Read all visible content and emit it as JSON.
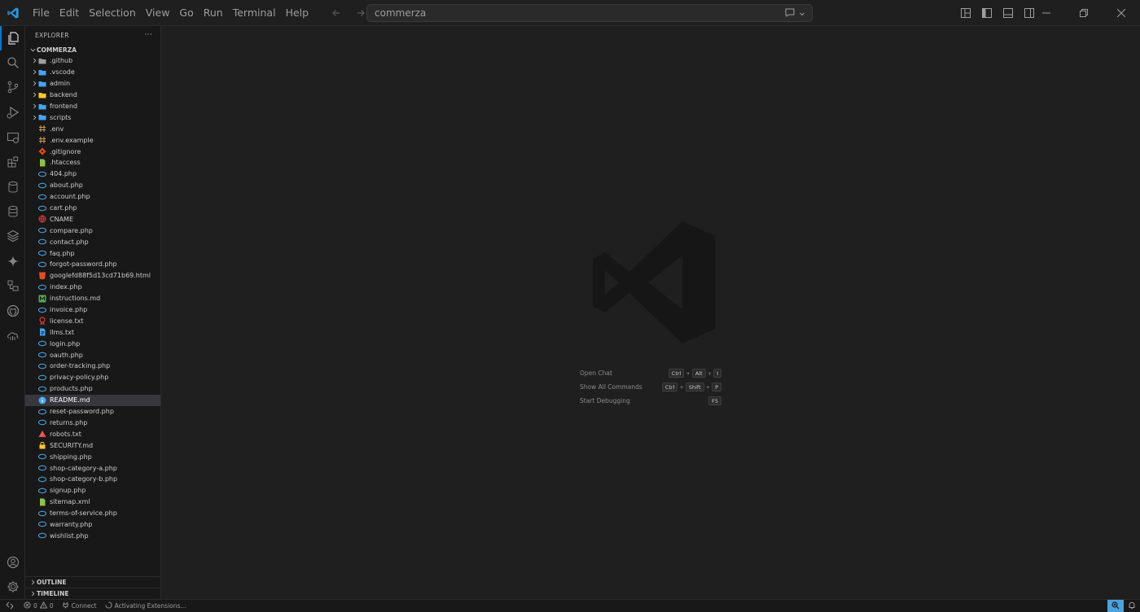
{
  "menu": [
    "File",
    "Edit",
    "Selection",
    "View",
    "Go",
    "Run",
    "Terminal",
    "Help"
  ],
  "command_center": {
    "text": "commerza"
  },
  "explorer": {
    "header": "EXPLORER",
    "more": "···",
    "root": "COMMERZA",
    "items": [
      {
        "name": ".github",
        "type": "folder",
        "icon": "github-folder-icon",
        "color": "#9e9e9e"
      },
      {
        "name": ".vscode",
        "type": "folder",
        "icon": "vscode-folder-icon",
        "color": "#42a5f5"
      },
      {
        "name": "admin",
        "type": "folder",
        "icon": "admin-folder-icon",
        "color": "#42a5f5"
      },
      {
        "name": "backend",
        "type": "folder",
        "icon": "folder-icon",
        "color": "#ffca28"
      },
      {
        "name": "frontend",
        "type": "folder",
        "icon": "folder-icon",
        "color": "#42a5f5"
      },
      {
        "name": "scripts",
        "type": "folder",
        "icon": "scripts-folder-icon",
        "color": "#42a5f5"
      },
      {
        "name": ".env",
        "type": "file",
        "icon": "env-icon",
        "color": "#c8a04b"
      },
      {
        "name": ".env.example",
        "type": "file",
        "icon": "env-icon",
        "color": "#c8a04b"
      },
      {
        "name": ".gitignore",
        "type": "file",
        "icon": "git-icon",
        "color": "#e64a19"
      },
      {
        "name": ".htaccess",
        "type": "file",
        "icon": "htaccess-icon",
        "color": "#8bc34a"
      },
      {
        "name": "404.php",
        "type": "file",
        "icon": "php-icon",
        "color": "#4c9fd8"
      },
      {
        "name": "about.php",
        "type": "file",
        "icon": "php-icon",
        "color": "#4c9fd8"
      },
      {
        "name": "account.php",
        "type": "file",
        "icon": "php-icon",
        "color": "#4c9fd8"
      },
      {
        "name": "cart.php",
        "type": "file",
        "icon": "php-icon",
        "color": "#4c9fd8"
      },
      {
        "name": "CNAME",
        "type": "file",
        "icon": "cname-icon",
        "color": "#e53935"
      },
      {
        "name": "compare.php",
        "type": "file",
        "icon": "php-icon",
        "color": "#4c9fd8"
      },
      {
        "name": "contact.php",
        "type": "file",
        "icon": "php-icon",
        "color": "#4c9fd8"
      },
      {
        "name": "faq.php",
        "type": "file",
        "icon": "php-icon",
        "color": "#4c9fd8"
      },
      {
        "name": "forgot-password.php",
        "type": "file",
        "icon": "php-icon",
        "color": "#4c9fd8"
      },
      {
        "name": "googlefd88f5d13cd71b69.html",
        "type": "file",
        "icon": "html-icon",
        "color": "#e44d26"
      },
      {
        "name": "index.php",
        "type": "file",
        "icon": "php-icon",
        "color": "#4c9fd8"
      },
      {
        "name": "instructions.md",
        "type": "file",
        "icon": "markdown-icon",
        "color": "#4caf50"
      },
      {
        "name": "invoice.php",
        "type": "file",
        "icon": "php-icon",
        "color": "#4c9fd8"
      },
      {
        "name": "license.txt",
        "type": "file",
        "icon": "license-icon",
        "color": "#e53935"
      },
      {
        "name": "llms.txt",
        "type": "file",
        "icon": "text-file-icon",
        "color": "#42a5f5"
      },
      {
        "name": "login.php",
        "type": "file",
        "icon": "php-icon",
        "color": "#4c9fd8"
      },
      {
        "name": "oauth.php",
        "type": "file",
        "icon": "php-icon",
        "color": "#4c9fd8"
      },
      {
        "name": "order-tracking.php",
        "type": "file",
        "icon": "php-icon",
        "color": "#4c9fd8"
      },
      {
        "name": "privacy-policy.php",
        "type": "file",
        "icon": "php-icon",
        "color": "#4c9fd8"
      },
      {
        "name": "products.php",
        "type": "file",
        "icon": "php-icon",
        "color": "#4c9fd8"
      },
      {
        "name": "README.md",
        "type": "file",
        "icon": "info-icon",
        "color": "#42a5f5",
        "selected": true
      },
      {
        "name": "reset-password.php",
        "type": "file",
        "icon": "php-icon",
        "color": "#4c9fd8"
      },
      {
        "name": "returns.php",
        "type": "file",
        "icon": "php-icon",
        "color": "#4c9fd8"
      },
      {
        "name": "robots.txt",
        "type": "file",
        "icon": "robot-icon",
        "color": "#ef5350"
      },
      {
        "name": "SECURITY.md",
        "type": "file",
        "icon": "lock-icon",
        "color": "#ffca28"
      },
      {
        "name": "shipping.php",
        "type": "file",
        "icon": "php-icon",
        "color": "#4c9fd8"
      },
      {
        "name": "shop-category-a.php",
        "type": "file",
        "icon": "php-icon",
        "color": "#4c9fd8"
      },
      {
        "name": "shop-category-b.php",
        "type": "file",
        "icon": "php-icon",
        "color": "#4c9fd8"
      },
      {
        "name": "signup.php",
        "type": "file",
        "icon": "php-icon",
        "color": "#4c9fd8"
      },
      {
        "name": "sitemap.xml",
        "type": "file",
        "icon": "xml-icon",
        "color": "#8bc34a"
      },
      {
        "name": "terms-of-service.php",
        "type": "file",
        "icon": "php-icon",
        "color": "#4c9fd8"
      },
      {
        "name": "warranty.php",
        "type": "file",
        "icon": "php-icon",
        "color": "#4c9fd8"
      },
      {
        "name": "wishlist.php",
        "type": "file",
        "icon": "php-icon",
        "color": "#4c9fd8"
      }
    ],
    "outline": "OUTLINE",
    "timeline": "TIMELINE"
  },
  "welcome": {
    "shortcuts": [
      {
        "label": "Open Chat",
        "keys": [
          "Ctrl",
          "Alt",
          "I"
        ]
      },
      {
        "label": "Show All Commands",
        "keys": [
          "Ctrl",
          "Shift",
          "P"
        ]
      },
      {
        "label": "Start Debugging",
        "keys": [
          "F5"
        ]
      }
    ]
  },
  "status": {
    "errors": "0",
    "warnings": "0",
    "connect": "Connect",
    "activity": "Activating Extensions..."
  },
  "colors": {
    "accent": "#0078d4",
    "selection": "#37373d",
    "editor_bg": "#1f1f1f",
    "sidebar_bg": "#181818"
  }
}
